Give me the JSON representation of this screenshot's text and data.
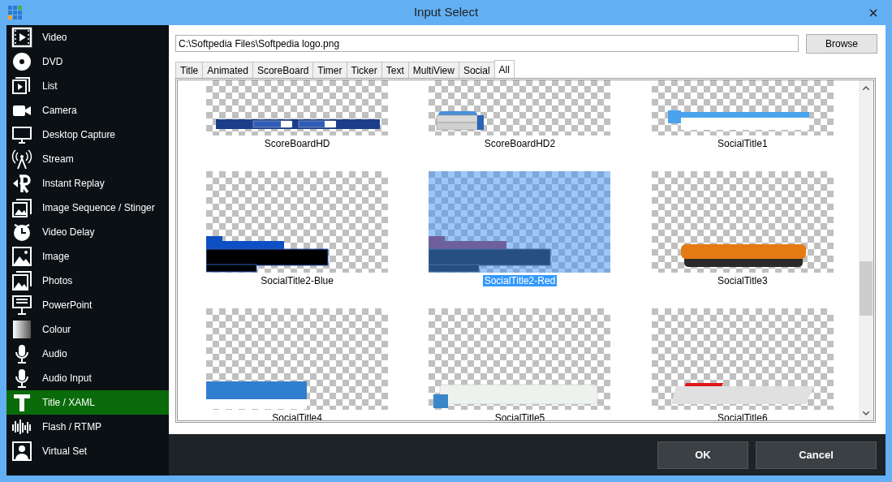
{
  "window": {
    "title": "Input Select"
  },
  "sidebar": {
    "items": [
      {
        "label": "Video",
        "kind": "video",
        "selected": false
      },
      {
        "label": "DVD",
        "kind": "dvd",
        "selected": false
      },
      {
        "label": "List",
        "kind": "list",
        "selected": false
      },
      {
        "label": "Camera",
        "kind": "camera",
        "selected": false
      },
      {
        "label": "Desktop Capture",
        "kind": "desktop",
        "selected": false
      },
      {
        "label": "Stream",
        "kind": "stream",
        "selected": false
      },
      {
        "label": "Instant Replay",
        "kind": "replay",
        "selected": false
      },
      {
        "label": "Image Sequence / Stinger",
        "kind": "sequence",
        "selected": false
      },
      {
        "label": "Video Delay",
        "kind": "delay",
        "selected": false
      },
      {
        "label": "Image",
        "kind": "image",
        "selected": false
      },
      {
        "label": "Photos",
        "kind": "photos",
        "selected": false
      },
      {
        "label": "PowerPoint",
        "kind": "presentation",
        "selected": false
      },
      {
        "label": "Colour",
        "kind": "colour",
        "selected": false
      },
      {
        "label": "Audio",
        "kind": "mic",
        "selected": false
      },
      {
        "label": "Audio Input",
        "kind": "mic",
        "selected": false
      },
      {
        "label": "Title / XAML",
        "kind": "title",
        "selected": true
      },
      {
        "label": "Flash / RTMP",
        "kind": "bars",
        "selected": false
      },
      {
        "label": "Virtual Set",
        "kind": "person",
        "selected": false
      }
    ]
  },
  "path_field": {
    "value": "C:\\Softpedia Files\\Softpedia logo.png"
  },
  "browse_button": "Browse",
  "tabs": [
    {
      "label": "Title",
      "selected": false
    },
    {
      "label": "Animated",
      "selected": false
    },
    {
      "label": "ScoreBoard",
      "selected": false
    },
    {
      "label": "Timer",
      "selected": false
    },
    {
      "label": "Ticker",
      "selected": false
    },
    {
      "label": "Text",
      "selected": false
    },
    {
      "label": "MultiView",
      "selected": false
    },
    {
      "label": "Social",
      "selected": false
    },
    {
      "label": "All",
      "selected": true
    }
  ],
  "templates": [
    {
      "label": "ScoreBoardHD",
      "kind": "scoreboard",
      "selected": false
    },
    {
      "label": "ScoreBoardHD2",
      "kind": "scoreboard2",
      "selected": false
    },
    {
      "label": "SocialTitle1",
      "kind": "social1",
      "selected": false
    },
    {
      "label": "SocialTitle2-Blue",
      "kind": "social2blue",
      "selected": false
    },
    {
      "label": "SocialTitle2-Red",
      "kind": "social2red",
      "selected": true
    },
    {
      "label": "SocialTitle3",
      "kind": "social3",
      "selected": false
    },
    {
      "label": "SocialTitle4",
      "kind": "social4",
      "selected": false
    },
    {
      "label": "SocialTitle5",
      "kind": "social5",
      "selected": false
    },
    {
      "label": "SocialTitle6",
      "kind": "social6",
      "selected": false
    }
  ],
  "buttons": [
    {
      "label": "OK"
    },
    {
      "label": "Cancel"
    }
  ]
}
